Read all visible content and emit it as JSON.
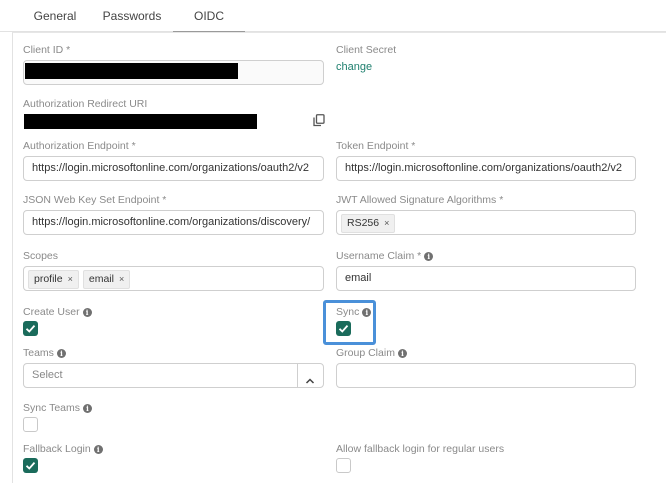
{
  "tabs": [
    {
      "label": "General",
      "active": false
    },
    {
      "label": "Passwords",
      "active": false
    },
    {
      "label": "OIDC",
      "active": true
    }
  ],
  "form": {
    "client_id": {
      "label": "Client ID *"
    },
    "client_secret": {
      "label": "Client Secret",
      "action": "change"
    },
    "redirect_uri": {
      "label": "Authorization Redirect URI"
    },
    "auth_endpoint": {
      "label": "Authorization Endpoint *",
      "value": "https://login.microsoftonline.com/organizations/oauth2/v2"
    },
    "token_endpoint": {
      "label": "Token Endpoint *",
      "value": "https://login.microsoftonline.com/organizations/oauth2/v2"
    },
    "jwks_endpoint": {
      "label": "JSON Web Key Set Endpoint *",
      "value": "https://login.microsoftonline.com/organizations/discovery/"
    },
    "jwt_algorithms": {
      "label": "JWT Allowed Signature Algorithms *",
      "tags": [
        "RS256"
      ]
    },
    "scopes": {
      "label": "Scopes",
      "tags": [
        "profile",
        "email"
      ]
    },
    "username_claim": {
      "label": "Username Claim *",
      "value": "email"
    },
    "create_user": {
      "label": "Create User",
      "checked": true
    },
    "sync": {
      "label": "Sync",
      "checked": true
    },
    "teams": {
      "label": "Teams",
      "placeholder": "Select"
    },
    "group_claim": {
      "label": "Group Claim",
      "value": ""
    },
    "sync_teams": {
      "label": "Sync Teams",
      "checked": false
    },
    "fallback_login": {
      "label": "Fallback Login",
      "checked": true
    },
    "allow_fallback_regular": {
      "label": "Allow fallback login for regular users",
      "checked": false
    }
  },
  "tag_remove_glyph": "×",
  "info_glyph": "i",
  "colors": {
    "accent": "#1a6b5b",
    "link": "#1e7f6e",
    "focus": "#4a90d9"
  }
}
